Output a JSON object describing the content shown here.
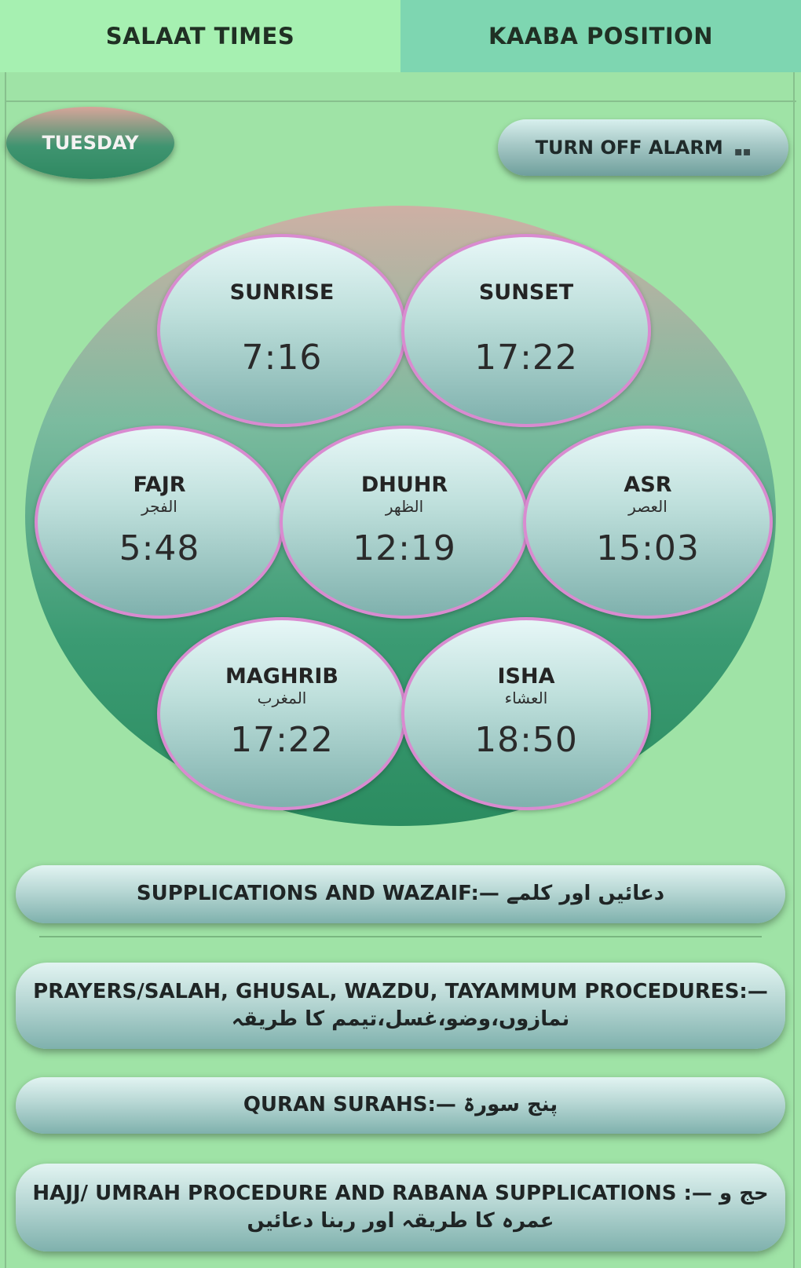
{
  "tabs": [
    {
      "label": "SALAAT TIMES",
      "active": true
    },
    {
      "label": "KAABA POSITION",
      "active": false
    }
  ],
  "day": "TUESDAY",
  "alarm": {
    "label": "TURN OFF ALARM"
  },
  "times": {
    "sunrise": {
      "label": "SUNRISE",
      "arabic": "",
      "time": "7:16"
    },
    "sunset": {
      "label": "SUNSET",
      "arabic": "",
      "time": "17:22"
    },
    "fajr": {
      "label": "FAJR",
      "arabic": "الفجر",
      "time": "5:48"
    },
    "dhuhr": {
      "label": "DHUHR",
      "arabic": "الظهر",
      "time": "12:19"
    },
    "asr": {
      "label": "ASR",
      "arabic": "العصر",
      "time": "15:03"
    },
    "maghrib": {
      "label": "MAGHRIB",
      "arabic": "المغرب",
      "time": "17:22"
    },
    "isha": {
      "label": "ISHA",
      "arabic": "العشاء",
      "time": "18:50"
    }
  },
  "menu": {
    "supplications": "SUPPLICATIONS AND WAZAIF:— دعائیں اور کلمے",
    "prayers": "PRAYERS/SALAH, GHUSAL, WAZDU, TAYAMMUM PROCEDURES:— نمازوں،وضو،غسل،تیمم کا طریقہ",
    "quran": "QURAN SURAHS:— پنج سورۃ",
    "hajj": "HAJJ/ UMRAH PROCEDURE AND RABANA SUPPLICATIONS :— حج و عمرہ کا طریقہ اور ربنا دعائیں"
  },
  "colors": {
    "background": "#9fe3a6",
    "tab_active": "#a6f0b1",
    "tab_inactive": "#7ed6b1",
    "bubble_border": "#d98bd0"
  }
}
